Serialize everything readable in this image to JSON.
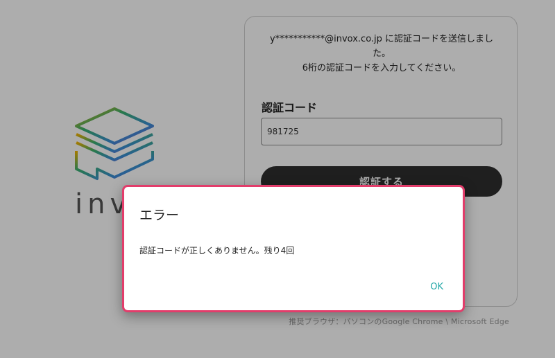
{
  "logo": {
    "text": "invox"
  },
  "card": {
    "message_line1": "y***********@invox.co.jp に認証コードを送信しました。",
    "message_line2": "6桁の認証コードを入力してください。",
    "code_label": "認証コード",
    "code_value": "981725",
    "verify_button": "認証する"
  },
  "browser_note": "推奨ブラウザ：パソコンのGoogle Chrome \\ Microsoft Edge",
  "dialog": {
    "title": "エラー",
    "message": "認証コードが正しくありません。残り4回",
    "ok_label": "OK"
  },
  "colors": {
    "dialog_border": "#e23d6b",
    "ok_text": "#22a7a7",
    "button_bg": "#2f2f2f"
  }
}
